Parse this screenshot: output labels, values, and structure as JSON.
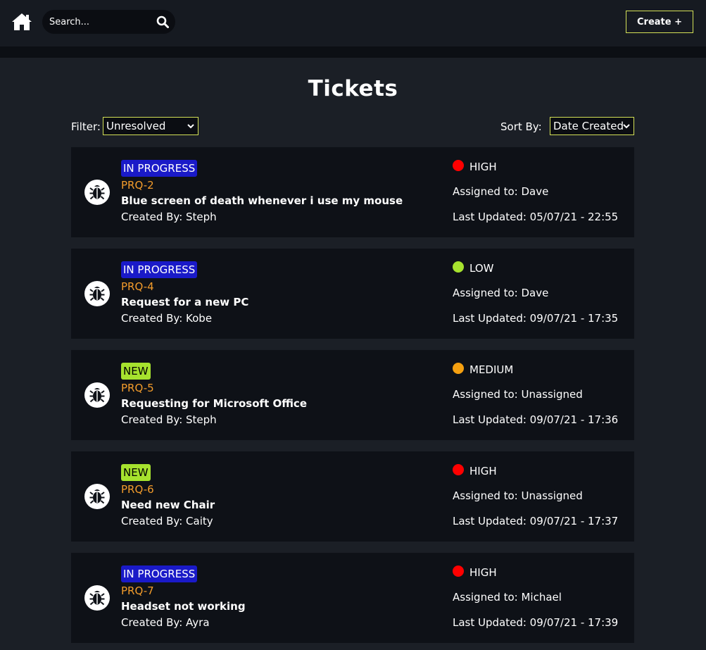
{
  "header": {
    "search_placeholder": "Search...",
    "create_label": "Create +"
  },
  "page": {
    "title": "Tickets",
    "filter_label": "Filter:",
    "filter_value": "Unresolved",
    "sort_label": "Sort By:",
    "sort_value": "Date Created"
  },
  "colors": {
    "accent_border": "#d4e157",
    "in_progress": "#1a1ac8",
    "new": "#a6e22e",
    "priority_high": "#ff0000",
    "priority_low": "#a6e22e",
    "priority_medium": "#f5a010",
    "ticket_id": "#f39c2b"
  },
  "tickets": [
    {
      "icon": "bug-icon",
      "status": "IN PROGRESS",
      "status_color": "#1a1ac8",
      "status_text_color": "#ffffff",
      "id": "PRQ-2",
      "title": "Blue screen of death whenever i use my mouse",
      "created_by": "Created By: Steph",
      "priority": "HIGH",
      "priority_color": "#ff0000",
      "assigned": "Assigned to: Dave",
      "updated": "Last Updated: 05/07/21 - 22:55"
    },
    {
      "icon": "bug-icon",
      "status": "IN PROGRESS",
      "status_color": "#1a1ac8",
      "status_text_color": "#ffffff",
      "id": "PRQ-4",
      "title": "Request for a new PC",
      "created_by": "Created By: Kobe",
      "priority": "LOW",
      "priority_color": "#a6e22e",
      "assigned": "Assigned to: Dave",
      "updated": "Last Updated: 09/07/21 - 17:35"
    },
    {
      "icon": "bug-icon",
      "status": "NEW",
      "status_color": "#a6e22e",
      "status_text_color": "#000000",
      "id": "PRQ-5",
      "title": "Requesting for Microsoft Office",
      "created_by": "Created By: Steph",
      "priority": "MEDIUM",
      "priority_color": "#f5a010",
      "assigned": "Assigned to: Unassigned",
      "updated": "Last Updated: 09/07/21 - 17:36"
    },
    {
      "icon": "bug-icon",
      "status": "NEW",
      "status_color": "#a6e22e",
      "status_text_color": "#000000",
      "id": "PRQ-6",
      "title": "Need new Chair",
      "created_by": "Created By: Caity",
      "priority": "HIGH",
      "priority_color": "#ff0000",
      "assigned": "Assigned to: Unassigned",
      "updated": "Last Updated: 09/07/21 - 17:37"
    },
    {
      "icon": "bug-icon",
      "status": "IN PROGRESS",
      "status_color": "#1a1ac8",
      "status_text_color": "#ffffff",
      "id": "PRQ-7",
      "title": "Headset not working",
      "created_by": "Created By: Ayra",
      "priority": "HIGH",
      "priority_color": "#ff0000",
      "assigned": "Assigned to: Michael",
      "updated": "Last Updated: 09/07/21 - 17:39"
    }
  ]
}
